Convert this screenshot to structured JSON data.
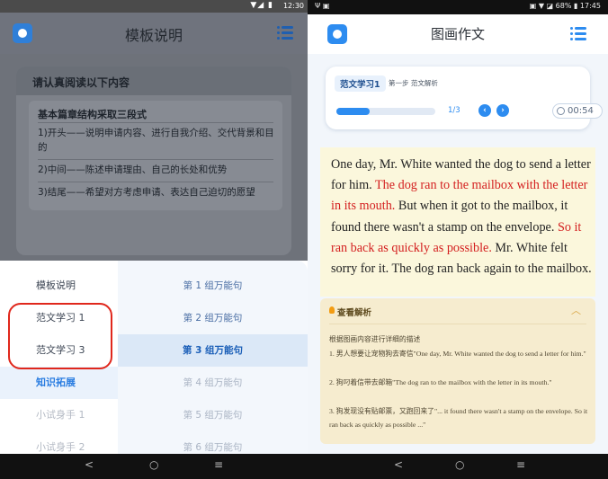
{
  "left": {
    "status_time": "12:30",
    "status_icons": "▼◢ ▮",
    "app_title": "模板说明",
    "card_header": "请认真阅读以下内容",
    "subtitle": "基本篇章结构采取三段式",
    "lines": [
      "1)开头——说明申请内容、进行自我介绍、交代背景和目的",
      "2)中间——陈述申请理由、自己的长处和优势",
      "3)结尾——希望对方考虑申请、表达自己迫切的愿望"
    ],
    "menu_left": [
      {
        "label": "模板说明",
        "state": "normal"
      },
      {
        "label": "范文学习 1",
        "state": "normal"
      },
      {
        "label": "范文学习 3",
        "state": "normal"
      },
      {
        "label": "知识拓展",
        "state": "active"
      },
      {
        "label": "小试身手 1",
        "state": "faded"
      },
      {
        "label": "小试身手 2",
        "state": "faded"
      }
    ],
    "menu_right": [
      {
        "label": "第 1 组万能句",
        "state": "normal"
      },
      {
        "label": "第 2 组万能句",
        "state": "normal"
      },
      {
        "label": "第 3 组万能句",
        "state": "active"
      },
      {
        "label": "第 4 组万能句",
        "state": "faded"
      },
      {
        "label": "第 5 组万能句",
        "state": "faded"
      },
      {
        "label": "第 6 组万能句",
        "state": "faded"
      }
    ],
    "nav": {
      "back": "<",
      "home": "○",
      "menu": "≡"
    }
  },
  "right": {
    "status_left": "Ψ ▣",
    "status_right": "▣ ▼ ◪ 68% ▮ 17:45",
    "app_title": "图画作文",
    "tag": "范文学习1",
    "step": "第一步 范文解析",
    "progress": 0.34,
    "counter": "1/3",
    "prev": "‹",
    "next": "›",
    "timer": "00:54",
    "essay_parts": [
      {
        "text": "One day, Mr. White wanted the dog to send a letter for him. ",
        "red": false
      },
      {
        "text": "The dog ran to the mailbox with the letter in its mouth.",
        "red": true
      },
      {
        "text": " But when it got to the mailbox, it found there wasn't a stamp on the envelope. ",
        "red": false
      },
      {
        "text": "So it ran back as quickly as possible.",
        "red": true
      },
      {
        "text": " Mr. White felt sorry for it. The dog ran back again to the mailbox.",
        "red": false
      }
    ],
    "analysis_title": "查看解析",
    "analysis_lines": [
      "根据图画内容进行详细的描述",
      "1. 男人想要让宠物狗去寄信\"One day, Mr. White wanted the dog to send a letter for him.\"",
      "2. 狗叼着信带去邮箱\"The dog ran to the mailbox with the letter in its mouth.\"",
      "3. 狗发现没有贴邮票，又跑回来了\"... it found there wasn't a stamp on the envelope. So it ran back as quickly as possible ...\""
    ],
    "nav": {
      "back": "<",
      "home": "○",
      "menu": "≡"
    }
  },
  "colors": {
    "accent": "#2d8cf0",
    "highlight_red": "#d42020",
    "ring_red": "#e0271c"
  }
}
